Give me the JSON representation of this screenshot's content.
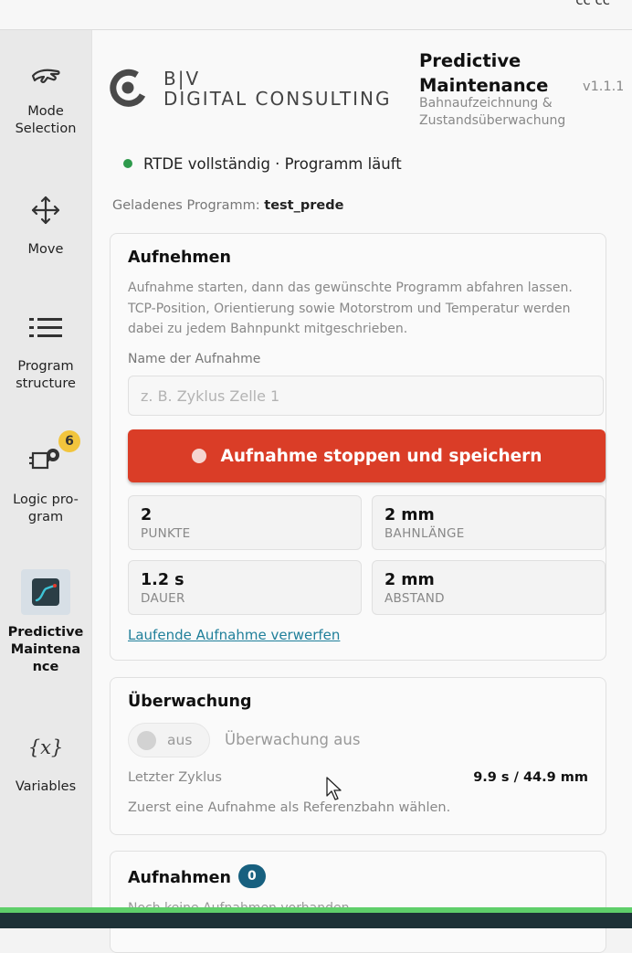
{
  "topbar": {
    "partial_text": "cc cc"
  },
  "sidebar": {
    "items": [
      {
        "label": "Mode Selection",
        "icon": "hand-icon"
      },
      {
        "label": "Move",
        "icon": "move-arrows-icon"
      },
      {
        "label": "Program structure",
        "icon": "list-icon"
      },
      {
        "label": "Logic pro-gram",
        "icon": "logic-chip-icon",
        "badge": "6"
      },
      {
        "label": "Predictive Maintena nce",
        "icon": "trend-chart-icon",
        "active": true
      },
      {
        "label": "Variables",
        "icon": "variable-x-icon"
      }
    ]
  },
  "header": {
    "logo_line1": "B|V",
    "logo_line2": "DIGITAL CONSULTING",
    "title_line1": "Predictive",
    "title_line2": "Maintenance",
    "subtitle_line1": "Bahnaufzeichnung &",
    "subtitle_line2": "Zustandsüberwachung",
    "version": "v1.1.1"
  },
  "status": {
    "text": "RTDE vollständig · Programm läuft",
    "color": "#2e9a4c"
  },
  "loaded_program": {
    "label": "Geladenes Programm:",
    "name": "test_prede"
  },
  "recording": {
    "title": "Aufnehmen",
    "description": "Aufnahme starten, dann das gewünschte Programm abfahren lassen. TCP-Position, Orientierung sowie Motorstrom und Temperatur werden dabei zu jedem Bahnpunkt mitgeschrieben.",
    "name_label": "Name der Aufnahme",
    "name_placeholder": "z. B. Zyklus Zelle 1",
    "stop_button": "Aufnahme stoppen und speichern",
    "stats": [
      {
        "value": "2",
        "label": "PUNKTE"
      },
      {
        "value": "2 mm",
        "label": "BAHNLÄNGE"
      },
      {
        "value": "1.2 s",
        "label": "DAUER"
      },
      {
        "value": "2 mm",
        "label": "ABSTAND"
      }
    ],
    "discard_link": "Laufende Aufnahme verwerfen",
    "accent_color": "#da3d27"
  },
  "monitoring": {
    "title": "Überwachung",
    "toggle_label": "aus",
    "state_text": "Überwachung aus",
    "last_cycle_label": "Letzter Zyklus",
    "last_cycle_value": "9.9 s / 44.9 mm",
    "hint": "Zuerst eine Aufnahme als Referenzbahn wählen."
  },
  "recordings": {
    "title": "Aufnahmen",
    "count": "0",
    "partial_text": "Noch keine Aufnahmen vorhanden."
  }
}
